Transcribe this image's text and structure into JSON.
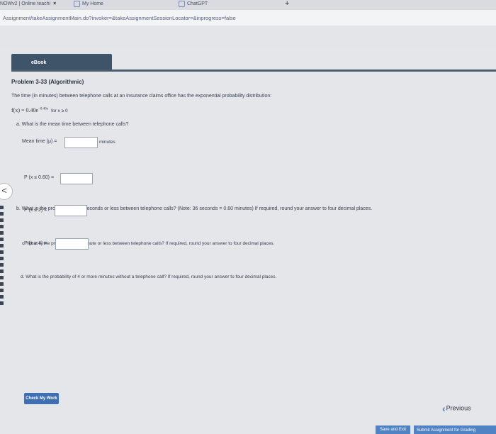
{
  "browser": {
    "tabs": [
      {
        "label": "NOWv2 | Online teachi"
      },
      {
        "label": "My Home"
      },
      {
        "label": "ChatGPT"
      }
    ],
    "address": "Assignment/takeAssignmentMain.do?invoker=&takeAssignmentSessionLocator=&inprogress=false",
    "new_tab": "+"
  },
  "ebook_tab": "eBook",
  "problem": {
    "title": "Problem 3-33 (Algorithmic)",
    "intro": "The time (in minutes) between telephone calls at an insurance claims office has the exponential probability distribution:",
    "formula_lhs": "f(x) = 0.40e",
    "formula_exp": "−0.40x",
    "formula_domain": "for x ≥ 0"
  },
  "questions": {
    "a": {
      "text": "a. What is the mean time between telephone calls?",
      "label": "Mean time (μ) =",
      "unit": "minutes",
      "value": ""
    },
    "b": {
      "text": "b. What is the probability of 36 seconds or less between telephone calls? (Note: 36 seconds = 0.60 minutes) If required, round your answer to four decimal places.",
      "label": "P (x ≤ 0.60) =",
      "value": ""
    },
    "c": {
      "text": "c. What is the probability of 2 minute or less between telephone calls? If required, round your answer to four decimal places.",
      "label": "P (x ≤ 2) =",
      "value": ""
    },
    "d": {
      "text": "d. What is the probability of 4 or more minutes without a telephone call? If required, round your answer to four decimal places.",
      "label": "P (x ≥ 4) =",
      "value": ""
    }
  },
  "buttons": {
    "check": "Check My Work",
    "previous": "Previous",
    "save": "Save and Exit",
    "submit": "Submit Assignment for Grading"
  }
}
